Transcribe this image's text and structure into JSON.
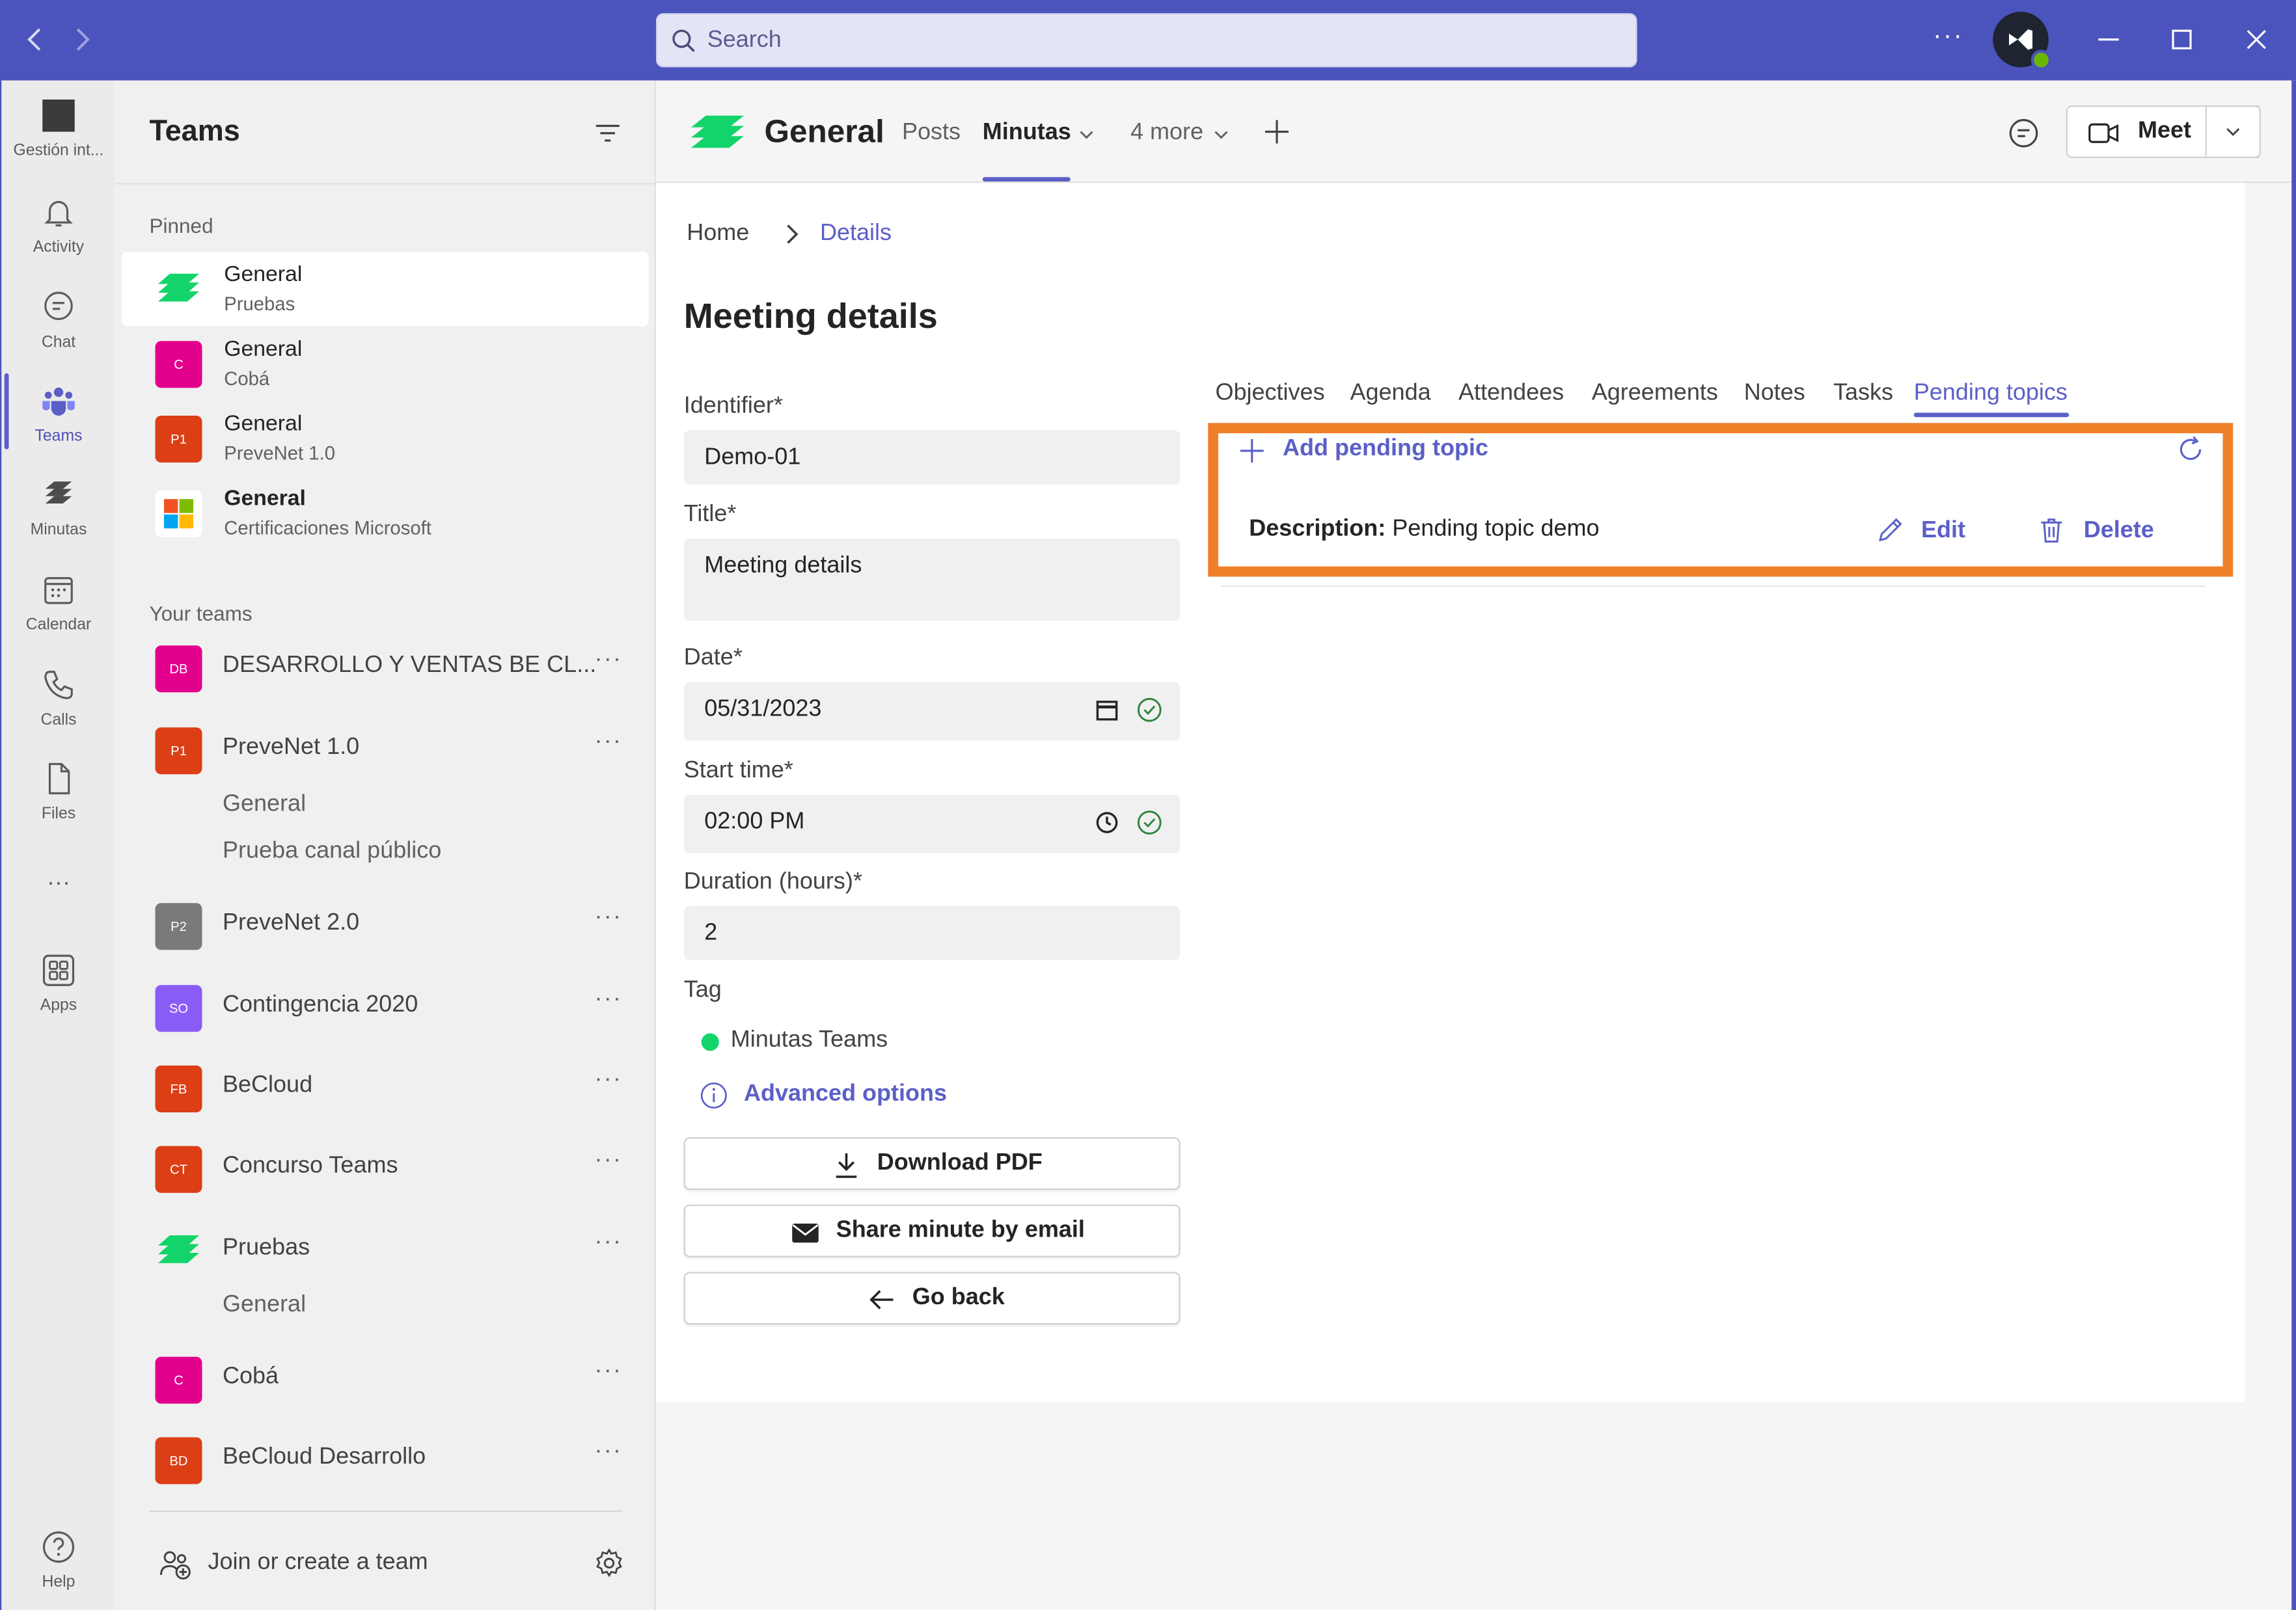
{
  "titlebar": {
    "search_placeholder": "Search",
    "more_label": "···",
    "colors": {
      "bar": "#4b53bc",
      "search": "#e3e4f5"
    }
  },
  "rail": {
    "items": [
      {
        "label": "Gestión int...",
        "icon": "app-tile-icon"
      },
      {
        "label": "Activity",
        "icon": "bell-icon"
      },
      {
        "label": "Chat",
        "icon": "chat-icon"
      },
      {
        "label": "Teams",
        "icon": "teams-icon",
        "active": true
      },
      {
        "label": "Minutas",
        "icon": "minutas-icon"
      },
      {
        "label": "Calendar",
        "icon": "calendar-icon"
      },
      {
        "label": "Calls",
        "icon": "phone-icon"
      },
      {
        "label": "Files",
        "icon": "file-icon"
      },
      {
        "label": "···",
        "icon": "more-icon"
      },
      {
        "label": "Apps",
        "icon": "apps-icon"
      },
      {
        "label": "Help",
        "icon": "help-icon"
      }
    ]
  },
  "teams_pane": {
    "title": "Teams",
    "pinned_label": "Pinned",
    "pinned": [
      {
        "title": "General",
        "subtitle": "Pruebas",
        "badge": "",
        "color": "#13d46b"
      },
      {
        "title": "General",
        "subtitle": "Cobá",
        "badge": "C",
        "color": "#e3008c"
      },
      {
        "title": "General",
        "subtitle": "PreveNet 1.0",
        "badge": "P1",
        "color": "#dc3e15"
      },
      {
        "title": "General",
        "subtitle": "Certificaciones Microsoft",
        "badge": "",
        "color": "#ffffff"
      }
    ],
    "your_teams_label": "Your teams",
    "teams": [
      {
        "badge": "DB",
        "name": "DESARROLLO Y VENTAS BE CL...",
        "color": "#e3008c"
      },
      {
        "badge": "P1",
        "name": "PreveNet 1.0",
        "color": "#dc3e15",
        "channels": [
          "General",
          "Prueba canal público"
        ]
      },
      {
        "badge": "P2",
        "name": "PreveNet 2.0",
        "color": "#7a7a7a"
      },
      {
        "badge": "SO",
        "name": "Contingencia 2020",
        "color": "#8a5cf6"
      },
      {
        "badge": "FB",
        "name": "BeCloud",
        "color": "#dc3e15"
      },
      {
        "badge": "CT",
        "name": "Concurso Teams",
        "color": "#dc3e15"
      },
      {
        "badge": "",
        "name": "Pruebas",
        "color": "#13d46b",
        "channels": [
          "General"
        ]
      },
      {
        "badge": "C",
        "name": "Cobá",
        "color": "#e3008c"
      },
      {
        "badge": "BD",
        "name": "BeCloud Desarrollo",
        "color": "#dc3e15"
      }
    ],
    "more_label": "···",
    "join_label": "Join or create a team"
  },
  "channel_header": {
    "title": "General",
    "tabs": [
      "Posts",
      "Minutas",
      "4 more"
    ],
    "meet_label": "Meet"
  },
  "breadcrumb": {
    "home": "Home",
    "current": "Details"
  },
  "form": {
    "title": "Meeting details",
    "identifier_label": "Identifier*",
    "identifier_value": "Demo-01",
    "title_label": "Title*",
    "title_value": "Meeting  details",
    "date_label": "Date*",
    "date_value": "05/31/2023",
    "start_label": "Start time*",
    "start_value": "02:00 PM",
    "duration_label": "Duration (hours)*",
    "duration_value": "2",
    "tag_label": "Tag",
    "tag_value": "Minutas Teams",
    "advanced_label": "Advanced options",
    "download_label": "Download PDF",
    "share_label": "Share minute by email",
    "back_label": "Go back"
  },
  "detail_tabs": [
    "Objectives",
    "Agenda",
    "Attendees",
    "Agreements",
    "Notes",
    "Tasks",
    "Pending topics"
  ],
  "pending": {
    "add_label": "Add pending topic",
    "desc_key": "Description:",
    "desc_value": " Pending topic demo",
    "edit_label": "Edit",
    "delete_label": "Delete",
    "highlight_color": "#f07f2a"
  }
}
